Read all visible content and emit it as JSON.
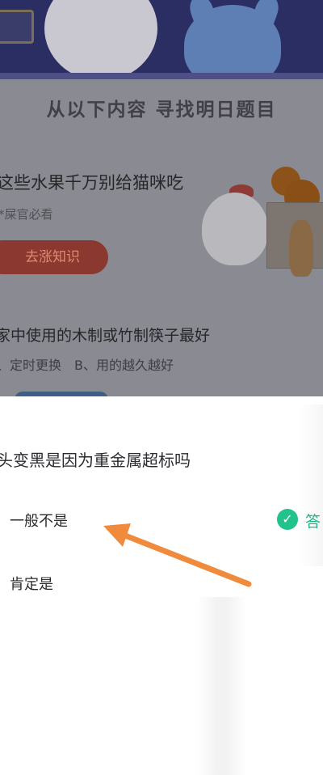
{
  "banner": {
    "headline": "从以下内容 寻找明日题目"
  },
  "card1": {
    "title": "这些水果千万别给猫咪吃",
    "subtitle": "*屎官必看",
    "button_label": "去涨知识"
  },
  "card2": {
    "title": "家中使用的木制或竹制筷子最好",
    "options_text": "、定时更换　B、用的越久越好"
  },
  "quiz": {
    "question": "头变黑是因为重金属超标吗",
    "options": [
      {
        "label": "、一般不是"
      },
      {
        "label": "、肯定是"
      }
    ],
    "answer_label": "答",
    "check_glyph": "✓"
  },
  "colors": {
    "correct": "#22c28c",
    "arrow": "#f08a3c",
    "learn_button": "#8a3830",
    "banner": "#2b2e63"
  },
  "icons": {
    "badge": "medal-badge-icon",
    "check": "check-circle-icon",
    "arrow": "annotation-arrow-icon"
  }
}
